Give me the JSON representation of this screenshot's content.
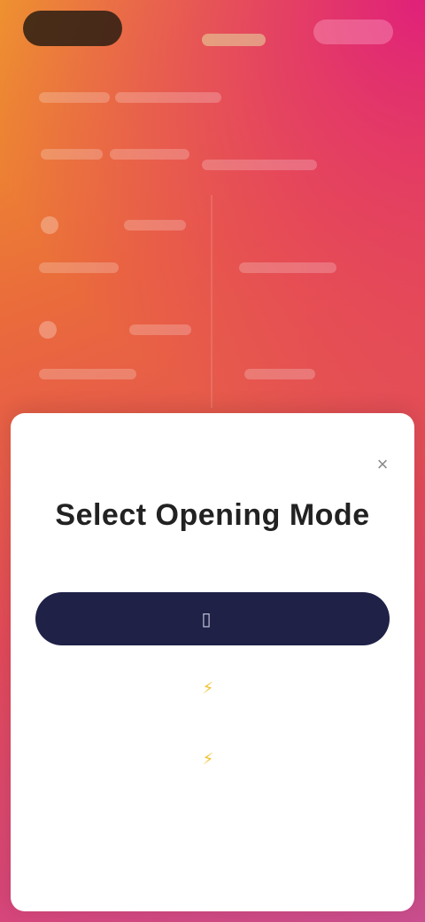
{
  "modal": {
    "title": "Select Opening Mode",
    "subtitle": "",
    "primary_button_label": "",
    "primary_button_icon": "phone-icon",
    "option_a_label": "",
    "option_a_icon": "lightning-icon",
    "option_b_label": "",
    "option_b_icon": "lightning-icon",
    "footer_link_label": "",
    "close_glyph": "×"
  },
  "colors": {
    "primary_button": "#1f2147",
    "accent_icon": "#f2c230",
    "gradient_start": "#ef9a2a",
    "gradient_end": "#c94e8e"
  }
}
